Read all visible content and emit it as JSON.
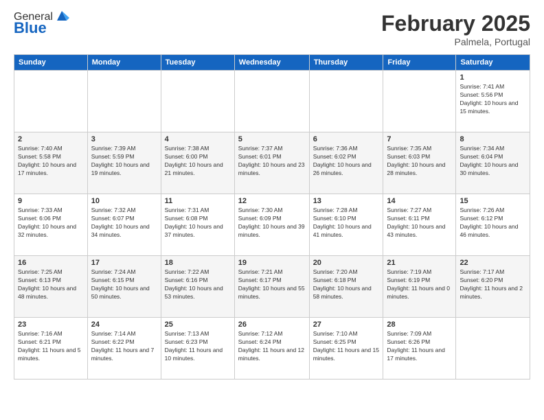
{
  "app": {
    "logo_general": "General",
    "logo_blue": "Blue",
    "month_title": "February 2025",
    "location": "Palmela, Portugal"
  },
  "weekdays": [
    "Sunday",
    "Monday",
    "Tuesday",
    "Wednesday",
    "Thursday",
    "Friday",
    "Saturday"
  ],
  "weeks": [
    [
      {
        "day": "",
        "info": ""
      },
      {
        "day": "",
        "info": ""
      },
      {
        "day": "",
        "info": ""
      },
      {
        "day": "",
        "info": ""
      },
      {
        "day": "",
        "info": ""
      },
      {
        "day": "",
        "info": ""
      },
      {
        "day": "1",
        "info": "Sunrise: 7:41 AM\nSunset: 5:56 PM\nDaylight: 10 hours and 15 minutes."
      }
    ],
    [
      {
        "day": "2",
        "info": "Sunrise: 7:40 AM\nSunset: 5:58 PM\nDaylight: 10 hours and 17 minutes."
      },
      {
        "day": "3",
        "info": "Sunrise: 7:39 AM\nSunset: 5:59 PM\nDaylight: 10 hours and 19 minutes."
      },
      {
        "day": "4",
        "info": "Sunrise: 7:38 AM\nSunset: 6:00 PM\nDaylight: 10 hours and 21 minutes."
      },
      {
        "day": "5",
        "info": "Sunrise: 7:37 AM\nSunset: 6:01 PM\nDaylight: 10 hours and 23 minutes."
      },
      {
        "day": "6",
        "info": "Sunrise: 7:36 AM\nSunset: 6:02 PM\nDaylight: 10 hours and 26 minutes."
      },
      {
        "day": "7",
        "info": "Sunrise: 7:35 AM\nSunset: 6:03 PM\nDaylight: 10 hours and 28 minutes."
      },
      {
        "day": "8",
        "info": "Sunrise: 7:34 AM\nSunset: 6:04 PM\nDaylight: 10 hours and 30 minutes."
      }
    ],
    [
      {
        "day": "9",
        "info": "Sunrise: 7:33 AM\nSunset: 6:06 PM\nDaylight: 10 hours and 32 minutes."
      },
      {
        "day": "10",
        "info": "Sunrise: 7:32 AM\nSunset: 6:07 PM\nDaylight: 10 hours and 34 minutes."
      },
      {
        "day": "11",
        "info": "Sunrise: 7:31 AM\nSunset: 6:08 PM\nDaylight: 10 hours and 37 minutes."
      },
      {
        "day": "12",
        "info": "Sunrise: 7:30 AM\nSunset: 6:09 PM\nDaylight: 10 hours and 39 minutes."
      },
      {
        "day": "13",
        "info": "Sunrise: 7:28 AM\nSunset: 6:10 PM\nDaylight: 10 hours and 41 minutes."
      },
      {
        "day": "14",
        "info": "Sunrise: 7:27 AM\nSunset: 6:11 PM\nDaylight: 10 hours and 43 minutes."
      },
      {
        "day": "15",
        "info": "Sunrise: 7:26 AM\nSunset: 6:12 PM\nDaylight: 10 hours and 46 minutes."
      }
    ],
    [
      {
        "day": "16",
        "info": "Sunrise: 7:25 AM\nSunset: 6:13 PM\nDaylight: 10 hours and 48 minutes."
      },
      {
        "day": "17",
        "info": "Sunrise: 7:24 AM\nSunset: 6:15 PM\nDaylight: 10 hours and 50 minutes."
      },
      {
        "day": "18",
        "info": "Sunrise: 7:22 AM\nSunset: 6:16 PM\nDaylight: 10 hours and 53 minutes."
      },
      {
        "day": "19",
        "info": "Sunrise: 7:21 AM\nSunset: 6:17 PM\nDaylight: 10 hours and 55 minutes."
      },
      {
        "day": "20",
        "info": "Sunrise: 7:20 AM\nSunset: 6:18 PM\nDaylight: 10 hours and 58 minutes."
      },
      {
        "day": "21",
        "info": "Sunrise: 7:19 AM\nSunset: 6:19 PM\nDaylight: 11 hours and 0 minutes."
      },
      {
        "day": "22",
        "info": "Sunrise: 7:17 AM\nSunset: 6:20 PM\nDaylight: 11 hours and 2 minutes."
      }
    ],
    [
      {
        "day": "23",
        "info": "Sunrise: 7:16 AM\nSunset: 6:21 PM\nDaylight: 11 hours and 5 minutes."
      },
      {
        "day": "24",
        "info": "Sunrise: 7:14 AM\nSunset: 6:22 PM\nDaylight: 11 hours and 7 minutes."
      },
      {
        "day": "25",
        "info": "Sunrise: 7:13 AM\nSunset: 6:23 PM\nDaylight: 11 hours and 10 minutes."
      },
      {
        "day": "26",
        "info": "Sunrise: 7:12 AM\nSunset: 6:24 PM\nDaylight: 11 hours and 12 minutes."
      },
      {
        "day": "27",
        "info": "Sunrise: 7:10 AM\nSunset: 6:25 PM\nDaylight: 11 hours and 15 minutes."
      },
      {
        "day": "28",
        "info": "Sunrise: 7:09 AM\nSunset: 6:26 PM\nDaylight: 11 hours and 17 minutes."
      },
      {
        "day": "",
        "info": ""
      }
    ]
  ]
}
